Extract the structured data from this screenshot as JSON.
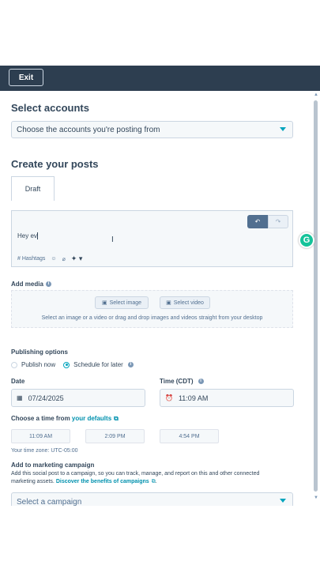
{
  "topbar": {
    "exit_label": "Exit"
  },
  "accounts": {
    "heading": "Select accounts",
    "placeholder": "Choose the accounts you're posting from"
  },
  "posts": {
    "heading": "Create your posts",
    "tab_label": "Draft",
    "editor_text": "Hey ev",
    "hashtags_label": "# Hashtags"
  },
  "media": {
    "heading": "Add media",
    "select_image": "Select image",
    "select_video": "Select video",
    "hint": "Select an image or a video or drag and drop images and videos straight from your desktop"
  },
  "publishing": {
    "heading": "Publishing options",
    "option_publish_now": "Publish now",
    "option_schedule": "Schedule for later",
    "selected": "Schedule for later"
  },
  "date": {
    "label": "Date",
    "value": "07/24/2025"
  },
  "time": {
    "label": "Time (CDT)",
    "value": "11:09 AM"
  },
  "defaults": {
    "prefix": "Choose a time from ",
    "link": "your defaults",
    "slots": [
      "11:09 AM",
      "2:09 PM",
      "4:54 PM"
    ],
    "timezone": "Your time zone: UTC-05:00"
  },
  "campaign": {
    "heading": "Add to marketing campaign",
    "description": "Add this social post to a campaign, so you can track, manage, and report on this and other connected marketing assets. ",
    "link": "Discover the benefits of campaigns",
    "placeholder": "Select a campaign"
  },
  "icons": [
    "undo-icon",
    "redo-icon",
    "emoji-icon",
    "attachment-icon",
    "ai-sparkle-icon",
    "info-icon",
    "calendar-icon",
    "clock-icon",
    "external-link-icon",
    "grammarly-icon",
    "text-cursor-icon"
  ],
  "colors": {
    "topbar": "#2d3e50",
    "accent": "#00a4bd",
    "link": "#0091ae"
  }
}
